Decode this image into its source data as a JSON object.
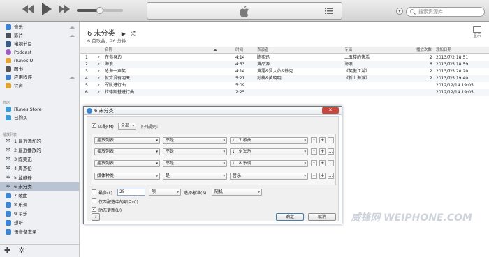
{
  "toolbar": {
    "search_placeholder": "搜索资源库"
  },
  "sidebar": {
    "library_items": [
      {
        "label": "音乐",
        "icon": "music-note-icon",
        "cloud": true
      },
      {
        "label": "影片",
        "icon": "film-icon",
        "cloud": true
      },
      {
        "label": "电视节目",
        "icon": "tv-icon",
        "cloud": false
      },
      {
        "label": "Podcast",
        "icon": "podcast-icon",
        "cloud": false
      },
      {
        "label": "iTunes U",
        "icon": "itunes-u-icon",
        "cloud": false
      },
      {
        "label": "图书",
        "icon": "book-icon",
        "cloud": false
      },
      {
        "label": "应用程序",
        "icon": "app-icon",
        "cloud": true
      },
      {
        "label": "铃声",
        "icon": "bell-icon",
        "cloud": false
      }
    ],
    "store_header": "商店",
    "store_items": [
      {
        "label": "iTunes Store",
        "icon": "store-icon"
      },
      {
        "label": "已购买",
        "icon": "purchased-icon"
      }
    ],
    "playlists_header": "播放列表",
    "playlists": [
      {
        "label": "1 最近添加的",
        "icon": "gear-icon"
      },
      {
        "label": "2 最近播放的",
        "icon": "gear-icon"
      },
      {
        "label": "3 陈奕迅",
        "icon": "gear-icon"
      },
      {
        "label": "4 周杰伦",
        "icon": "gear-icon"
      },
      {
        "label": "5 篮静静",
        "icon": "gear-icon"
      },
      {
        "label": "6 未分类",
        "icon": "gear-icon",
        "selected": true
      },
      {
        "label": "7 歌曲",
        "icon": "playlist-icon"
      },
      {
        "label": "8 乐调",
        "icon": "playlist-icon"
      },
      {
        "label": "9 军乐",
        "icon": "playlist-icon"
      },
      {
        "label": "想听",
        "icon": "playlist-icon"
      },
      {
        "label": "语音备忘录",
        "icon": "playlist-icon"
      }
    ]
  },
  "playlist": {
    "title": "6 未分类",
    "subtitle": "6 首歌曲，26 分钟",
    "show_label": "显示"
  },
  "table": {
    "headers": {
      "name": "名称",
      "time": "时间",
      "artist": "表演者",
      "album": "专辑",
      "plays": "播放次数",
      "date_added": "添加日期"
    },
    "rows": [
      {
        "num": "1",
        "name": "在你身边",
        "time": "4:14",
        "artist": "陈奕迅",
        "album": "上五楼的快活",
        "plays": "2",
        "date_added": "2013/7/2 18:51"
      },
      {
        "num": "2",
        "name": "海浪",
        "time": "4:53",
        "artist": "黄品源",
        "album": "海浪",
        "plays": "6",
        "date_added": "2013/7/5 18:59"
      },
      {
        "num": "3",
        "name": "沧海一声笑",
        "time": "4:14",
        "artist": "黄霑&罗大佑&徐克",
        "album": "《笑傲江湖》",
        "plays": "2",
        "date_added": "2013/7/5 20:20"
      },
      {
        "num": "4",
        "name": "就算没有明天",
        "time": "5:21",
        "artist": "孙楠&黄晓明",
        "album": "《新上海滩》",
        "plays": "2",
        "date_added": "2013/7/5 19:40"
      },
      {
        "num": "5",
        "name": "军队进行曲",
        "time": "5:09",
        "artist": "",
        "album": "",
        "plays": "",
        "date_added": "2012/12/14 19:05"
      },
      {
        "num": "6",
        "name": "拉德斯基进行曲",
        "time": "2:25",
        "artist": "",
        "album": "",
        "plays": "",
        "date_added": "2012/12/14 19:05"
      }
    ]
  },
  "dialog": {
    "title": "6 未分类",
    "close": "✕",
    "match_label": "匹配(M)",
    "match_scope": "全部",
    "match_suffix": "下列规则:",
    "rules": [
      {
        "field": "播放列表",
        "op": "不是",
        "value": "7 歌曲"
      },
      {
        "field": "播放列表",
        "op": "不是",
        "value": "9 军乐"
      },
      {
        "field": "播放列表",
        "op": "不是",
        "value": "8 乐调"
      },
      {
        "field": "媒体种类",
        "op": "是",
        "value": "音乐"
      }
    ],
    "limit_label": "最多(L)",
    "limit_value": "25",
    "limit_unit": "项",
    "select_by_label": "选择标准(S)",
    "select_by_value": "随机",
    "only_checked_label": "仅匹配选中的项目(C)",
    "live_update_label": "动态更新(U)",
    "help": "?",
    "ok": "确定",
    "cancel": "取消"
  },
  "watermark": "威锋网 WEIPHONE.COM"
}
